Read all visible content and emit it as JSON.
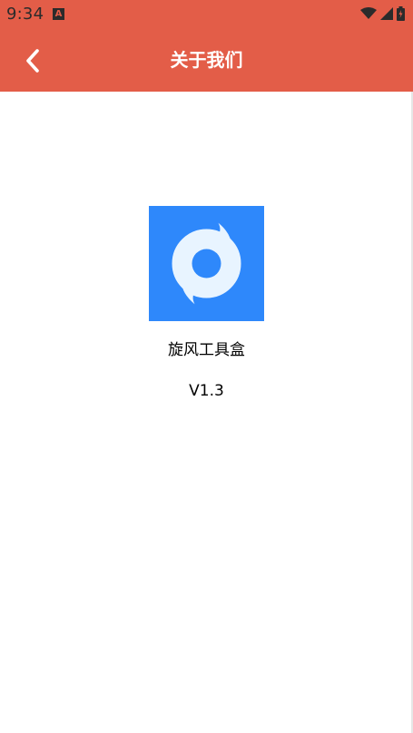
{
  "status_bar": {
    "time": "9:34",
    "notification_icon": "A"
  },
  "toolbar": {
    "title": "关于我们",
    "back_icon": "chevron-left-icon"
  },
  "about": {
    "app_name": "旋风工具盒",
    "version": "V1.3"
  },
  "colors": {
    "header": "#e35d48",
    "logo_bg": "#2e88fb",
    "logo_fg": "#e8f4ff"
  }
}
